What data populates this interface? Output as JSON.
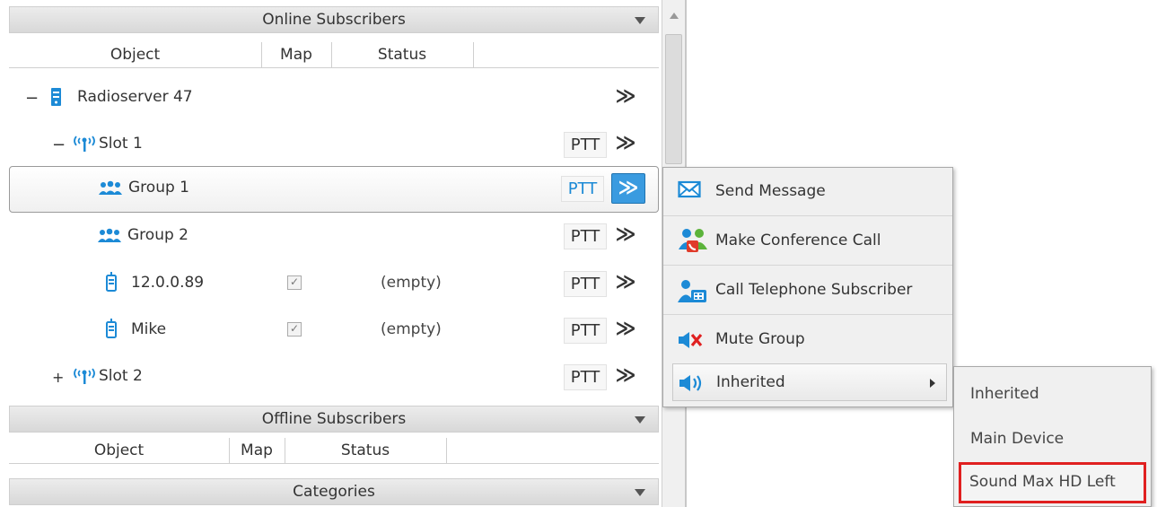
{
  "online": {
    "header": "Online Subscribers",
    "columns": [
      "Object",
      "Map",
      "Status"
    ],
    "rows": [
      {
        "toggle": "−",
        "icon": "server-icon",
        "label": "Radioserver 47"
      },
      {
        "toggle": "−",
        "icon": "radio-tower-icon",
        "label": "Slot 1",
        "ptt": "PTT"
      },
      {
        "icon": "group-icon",
        "label": "Group 1",
        "ptt": "PTT"
      },
      {
        "icon": "group-icon",
        "label": "Group 2",
        "ptt": "PTT"
      },
      {
        "icon": "handheld-radio-icon",
        "label": "12.0.0.89",
        "map_checked": true,
        "status": "(empty)",
        "ptt": "PTT"
      },
      {
        "icon": "handheld-radio-icon",
        "label": "Mike",
        "map_checked": true,
        "status": "(empty)",
        "ptt": "PTT"
      },
      {
        "toggle": "+",
        "icon": "radio-tower-icon",
        "label": "Slot 2",
        "ptt": "PTT"
      }
    ],
    "more_glyph": "≫"
  },
  "offline": {
    "header": "Offline Subscribers",
    "columns": [
      "Object",
      "Map",
      "Status"
    ]
  },
  "categories": {
    "header": "Categories"
  },
  "context_menu": {
    "items": [
      {
        "icon": "envelope-icon",
        "label": "Send Message"
      },
      {
        "icon": "conference-call-icon",
        "label": "Make Conference Call"
      },
      {
        "icon": "telephone-subscriber-icon",
        "label": "Call Telephone Subscriber"
      },
      {
        "icon": "mute-speaker-icon",
        "label": "Mute Group"
      },
      {
        "icon": "speaker-icon",
        "label": "Inherited",
        "has_submenu": true
      }
    ]
  },
  "submenu": {
    "items": [
      "Inherited",
      "Main Device",
      "Sound Max HD Left"
    ],
    "highlighted_index": 2
  },
  "colors": {
    "accent_blue": "#1c8ad6",
    "highlight_red": "#e02020"
  }
}
